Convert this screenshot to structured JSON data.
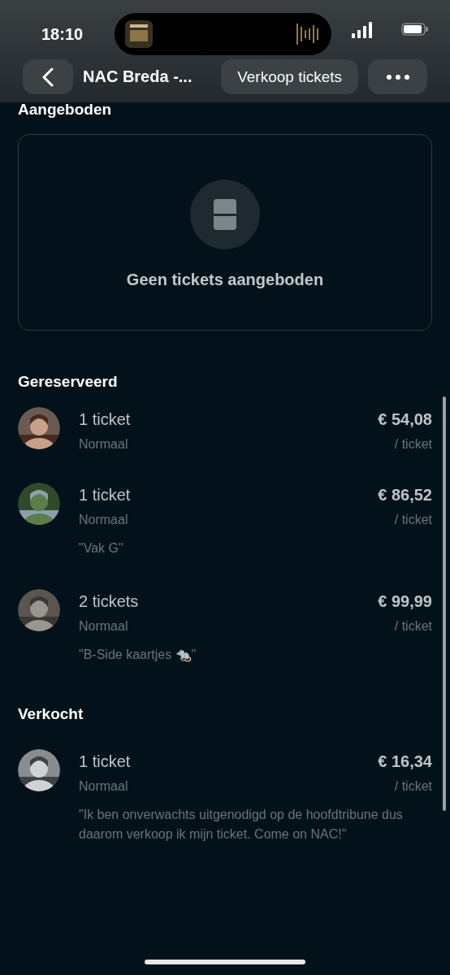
{
  "status_bar": {
    "time": "18:10"
  },
  "nav": {
    "title": "NAC Breda -...",
    "action": "Verkoop tickets"
  },
  "offered": {
    "heading": "Aangeboden",
    "empty_text": "Geen tickets aangeboden"
  },
  "sections": [
    {
      "heading": "Gereserveerd",
      "items": [
        {
          "quantity": "1 ticket",
          "type": "Normaal",
          "price": "€ 54,08",
          "unit": "/ ticket"
        },
        {
          "quantity": "1 ticket",
          "type": "Normaal",
          "price": "€ 86,52",
          "unit": "/ ticket",
          "note": "\"Vak G\""
        },
        {
          "quantity": "2 tickets",
          "type": "Normaal",
          "price": "€ 99,99",
          "unit": "/ ticket",
          "note": "\"B-Side kaartjes 🐀\""
        }
      ]
    },
    {
      "heading": "Verkocht",
      "items": [
        {
          "quantity": "1 ticket",
          "type": "Normaal",
          "price": "€ 16,34",
          "unit": "/ ticket",
          "note": "\"Ik ben onverwachts uitgenodigd op de hoofdtribune dus daarom verkoop ik mijn ticket. Come on NAC!\""
        }
      ]
    }
  ]
}
